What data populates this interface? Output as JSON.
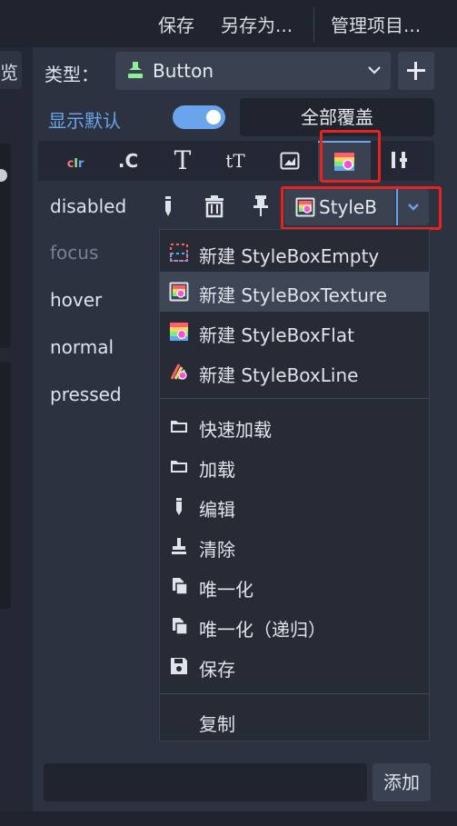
{
  "topbar": {
    "save": "保存",
    "save_as": "另存为...",
    "manage_items": "管理项目..."
  },
  "left": {
    "tab_fragment": "览"
  },
  "type_row": {
    "label": "类型：",
    "selected": "Button",
    "type_icon": "button-node-icon",
    "add_icon": "plus-icon"
  },
  "default_row": {
    "show_default_label": "显示默认",
    "show_default_on": true,
    "override_all": "全部覆盖"
  },
  "tabs": [
    {
      "label": "clr",
      "icon": "color-icon"
    },
    {
      "label": ".C",
      "icon": "constant-icon"
    },
    {
      "label": "T",
      "icon": "font-icon"
    },
    {
      "label": "tT",
      "icon": "font-size-icon"
    },
    {
      "label": "",
      "icon": "image-icon"
    },
    {
      "label": "",
      "icon": "stylebox-icon",
      "active": true
    },
    {
      "label": "",
      "icon": "theme-type-icon"
    }
  ],
  "properties": [
    {
      "name": "disabled",
      "dim": false
    },
    {
      "name": "focus",
      "dim": true
    },
    {
      "name": "hover",
      "dim": false
    },
    {
      "name": "normal",
      "dim": false
    },
    {
      "name": "pressed",
      "dim": false
    }
  ],
  "stylebox_value": "StyleB",
  "menu": {
    "new_items": [
      {
        "label": "新建 StyleBoxEmpty",
        "icon": "stylebox-empty-icon"
      },
      {
        "label": "新建 StyleBoxTexture",
        "icon": "stylebox-texture-icon",
        "hover": true
      },
      {
        "label": "新建 StyleBoxFlat",
        "icon": "stylebox-flat-icon"
      },
      {
        "label": "新建 StyleBoxLine",
        "icon": "stylebox-line-icon"
      }
    ],
    "actions": [
      {
        "label": "快速加载",
        "icon": "folder-icon"
      },
      {
        "label": "加载",
        "icon": "folder-icon"
      },
      {
        "label": "编辑",
        "icon": "edit-icon"
      },
      {
        "label": "清除",
        "icon": "clear-icon"
      },
      {
        "label": "唯一化",
        "icon": "duplicate-icon"
      },
      {
        "label": "唯一化（递归）",
        "icon": "duplicate-icon"
      },
      {
        "label": "保存",
        "icon": "save-icon"
      }
    ],
    "copy": "复制"
  },
  "bottom": {
    "add": "添加"
  },
  "colors": {
    "accent": "#6aa4ec",
    "highlight_box": "#e8231f",
    "panel": "#2c3240"
  }
}
